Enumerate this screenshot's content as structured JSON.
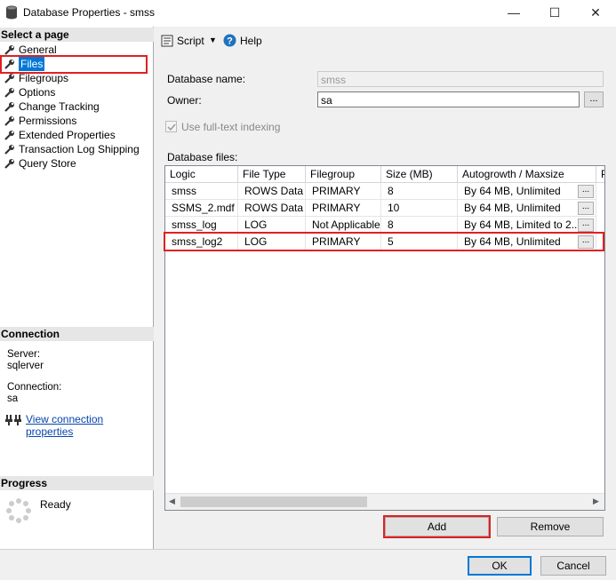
{
  "window": {
    "title": "Database Properties - smss",
    "minimize": "—",
    "maximize": "☐",
    "close": "✕"
  },
  "left": {
    "select_page_header": "Select a page",
    "pages": [
      "General",
      "Files",
      "Filegroups",
      "Options",
      "Change Tracking",
      "Permissions",
      "Extended Properties",
      "Transaction Log Shipping",
      "Query Store"
    ],
    "connection_header": "Connection",
    "server_label": "Server:",
    "server_value": "sqlerver",
    "connection_label": "Connection:",
    "connection_value": "sa",
    "view_conn_link": "View connection properties",
    "progress_header": "Progress",
    "progress_status": "Ready"
  },
  "toolbar": {
    "script_label": "Script",
    "help_label": "Help"
  },
  "form": {
    "db_name_label": "Database name:",
    "db_name_value": "smss",
    "owner_label": "Owner:",
    "owner_value": "sa",
    "owner_browse": "...",
    "fulltext_label": "Use full-text indexing",
    "db_files_label": "Database files:"
  },
  "grid": {
    "headers": [
      "Logic",
      "File Type",
      "Filegroup",
      "Size (MB)",
      "Autogrowth / Maxsize",
      "P"
    ],
    "rows": [
      [
        "smss",
        "ROWS Data",
        "PRIMARY",
        "8",
        "By 64 MB, Unlimited"
      ],
      [
        "SSMS_2.mdf",
        "ROWS Data",
        "PRIMARY",
        "10",
        "By 64 MB, Unlimited"
      ],
      [
        "smss_log",
        "LOG",
        "Not Applicable",
        "8",
        "By 64 MB, Limited to 2..."
      ],
      [
        "smss_log2",
        "LOG",
        "PRIMARY",
        "5",
        "By 64 MB, Unlimited"
      ]
    ],
    "row_button": "..."
  },
  "buttons": {
    "add": "Add",
    "remove": "Remove",
    "ok": "OK",
    "cancel": "Cancel"
  },
  "colors": {
    "accent": "#0078d7",
    "highlight": "#e02020"
  }
}
